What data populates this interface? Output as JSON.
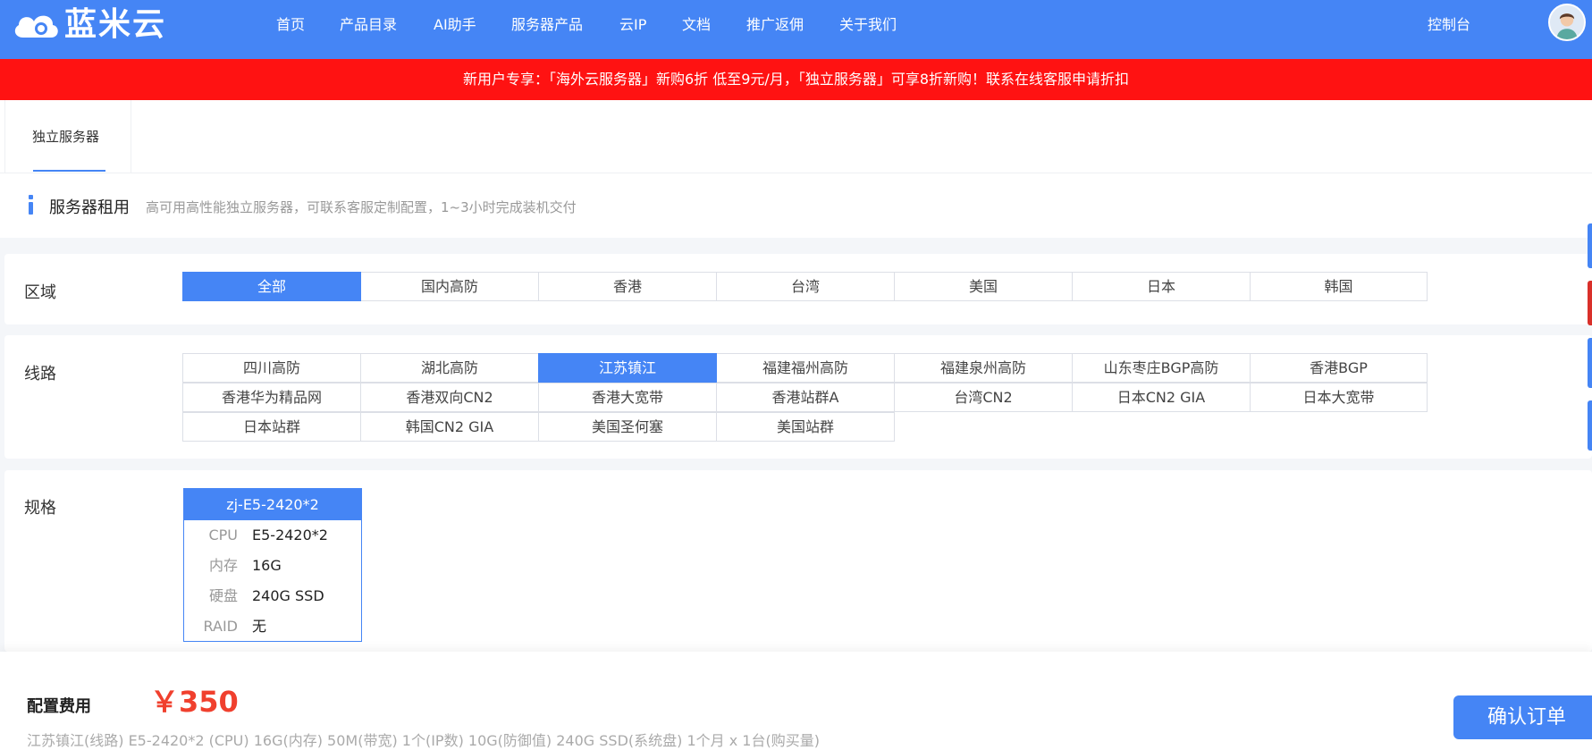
{
  "header": {
    "logo_text": "蓝米云",
    "nav": [
      "首页",
      "产品目录",
      "AI助手",
      "服务器产品",
      "云IP",
      "文档",
      "推广返佣",
      "关于我们"
    ],
    "console": "控制台"
  },
  "promo_text": "新用户专享：「海外云服务器」新购6折 低至9元/月，「独立服务器」可享8折新购！联系在线客服申请折扣",
  "tabs": [
    {
      "label": "独立服务器",
      "active": true
    }
  ],
  "page": {
    "title": "服务器租用",
    "subtitle": "高可用高性能独立服务器，可联系客服定制配置，1~3小时完成装机交付"
  },
  "region": {
    "label": "区域",
    "options": [
      "全部",
      "国内高防",
      "香港",
      "台湾",
      "美国",
      "日本",
      "韩国"
    ],
    "selected": "全部"
  },
  "line": {
    "label": "线路",
    "options": [
      "四川高防",
      "湖北高防",
      "江苏镇江",
      "福建福州高防",
      "福建泉州高防",
      "山东枣庄BGP高防",
      "香港BGP",
      "香港华为精品网",
      "香港双向CN2",
      "香港大宽带",
      "香港站群A",
      "台湾CN2",
      "日本CN2 GIA",
      "日本大宽带",
      "日本站群",
      "韩国CN2 GIA",
      "美国圣何塞",
      "美国站群"
    ],
    "selected": "江苏镇江"
  },
  "spec": {
    "label": "规格",
    "card": {
      "name": "zj-E5-2420*2",
      "rows": [
        {
          "key": "CPU",
          "value": "E5-2420*2"
        },
        {
          "key": "内存",
          "value": "16G"
        },
        {
          "key": "硬盘",
          "value": "240G SSD"
        },
        {
          "key": "RAID",
          "value": "无"
        }
      ]
    }
  },
  "footer": {
    "fee_label": "配置费用",
    "price": "￥350",
    "summary": "江苏镇江(线路)  E5-2420*2 (CPU) 16G(内存) 50M(带宽) 1个(IP数) 10G(防御值) 240G SSD(系统盘) 1个月 x 1台(购买量)",
    "confirm": "确认订单"
  },
  "colors": {
    "primary": "#4585f5",
    "promo_bg": "#ff1212",
    "price": "#f0402e"
  }
}
